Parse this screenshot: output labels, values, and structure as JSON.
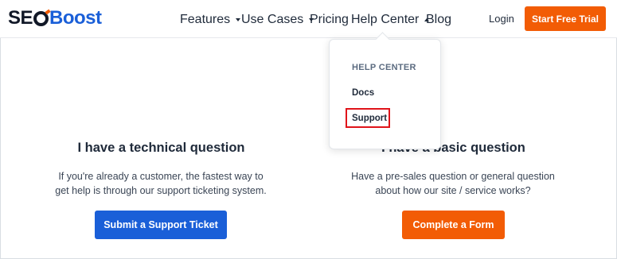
{
  "logo": {
    "seo": "SE",
    "boost": "Boost"
  },
  "nav": {
    "items": [
      {
        "label": "Features",
        "has_caret": true
      },
      {
        "label": "Use Cases",
        "has_caret": true
      },
      {
        "label": "Pricing",
        "has_caret": false
      },
      {
        "label": "Help Center",
        "has_caret": true,
        "open": true
      },
      {
        "label": "Blog",
        "has_caret": false
      }
    ],
    "login": "Login",
    "cta": "Start Free Trial"
  },
  "dropdown": {
    "heading": "HELP CENTER",
    "items": [
      {
        "label": "Docs"
      },
      {
        "label": "Support",
        "highlighted": true
      }
    ]
  },
  "columns": [
    {
      "title": "I have a technical question",
      "description_line1": "If you're already a customer, the fastest way to",
      "description_line2": "get help is through our support ticketing system.",
      "button": "Submit a Support Ticket"
    },
    {
      "title": "I have a basic question",
      "description_line1": "Have a pre-sales question or general question",
      "description_line2": "about how our site / service works?",
      "button": "Complete a Form"
    }
  ],
  "colors": {
    "brand_blue": "#1a5fd8",
    "brand_orange": "#f25c05",
    "highlight_red": "#e0141a"
  }
}
